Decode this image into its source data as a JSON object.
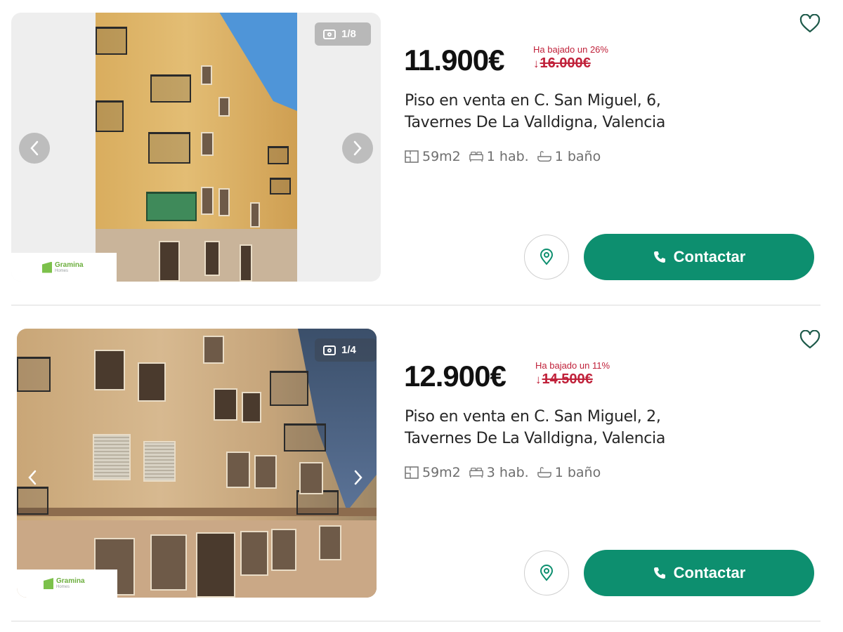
{
  "listings": [
    {
      "photo_counter": "1/8",
      "agency_logo": {
        "name": "Gramina",
        "sub": "Homes"
      },
      "price": "11.900€",
      "price_drop_label": "Ha bajado un 26%",
      "old_price": "16.000€",
      "title": "Piso en venta en C. San Miguel, 6, Tavernes De La Valldigna, Valencia",
      "area": "59m2",
      "rooms": "1 hab.",
      "baths": "1 baño",
      "contact_label": "Contactar"
    },
    {
      "photo_counter": "1/4",
      "agency_logo": {
        "name": "Gramina",
        "sub": "Homes"
      },
      "price": "12.900€",
      "price_drop_label": "Ha bajado un 11%",
      "old_price": "14.500€",
      "title": "Piso en venta en C. San Miguel, 2, Tavernes De La Valldigna, Valencia",
      "area": "59m2",
      "rooms": "3 hab.",
      "baths": "1 baño",
      "contact_label": "Contactar"
    }
  ],
  "icons": {
    "camera": "camera-icon",
    "prev": "chevron-left-icon",
    "next": "chevron-right-icon",
    "favorite": "heart-icon",
    "map": "map-pin-icon",
    "phone": "phone-icon",
    "area": "floor-plan-icon",
    "rooms": "bed-icon",
    "baths": "bathtub-icon"
  },
  "colors": {
    "accent": "#0d8f6f",
    "price_drop": "#c0213a",
    "brand_logo": "#6cae3d"
  }
}
